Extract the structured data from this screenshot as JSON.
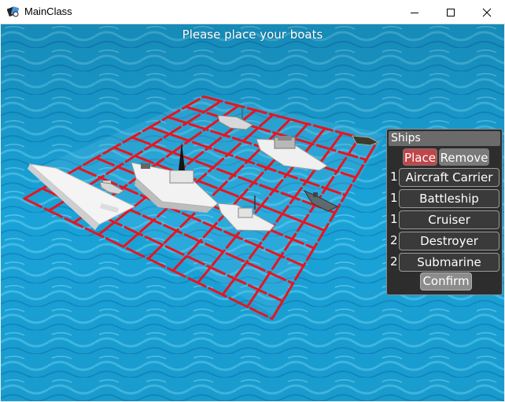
{
  "window": {
    "title": "MainClass"
  },
  "hud": {
    "message": "Please place your boats"
  },
  "panel": {
    "title": "Ships",
    "modes": {
      "place": "Place",
      "remove": "Remove",
      "selected": "Place"
    },
    "ships": [
      {
        "count": "1",
        "name": "Aircraft Carrier"
      },
      {
        "count": "1",
        "name": "Battleship"
      },
      {
        "count": "1",
        "name": "Cruiser"
      },
      {
        "count": "2",
        "name": "Destroyer"
      },
      {
        "count": "2",
        "name": "Submarine"
      }
    ],
    "confirm": "Confirm"
  },
  "colors": {
    "grid": "#e8141e",
    "water": "#1aa6dc",
    "place_active": "#c0464a",
    "panel_bg": "#2d2d2d"
  }
}
